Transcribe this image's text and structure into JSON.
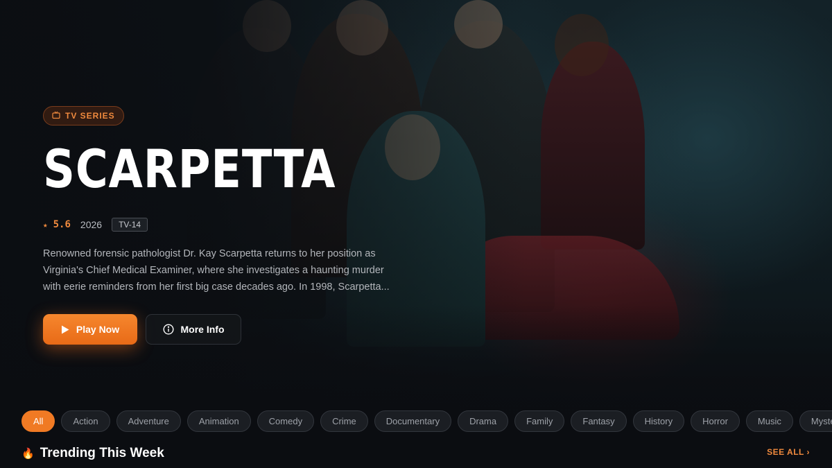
{
  "hero": {
    "type_badge": "TV SERIES",
    "title": "SCARPETTA",
    "rating": "5.6",
    "year": "2026",
    "age_rating": "TV-14",
    "description": "Renowned forensic pathologist Dr. Kay Scarpetta returns to her position as Virginia's Chief Medical Examiner, where she investigates a haunting murder with eerie reminders from her first big case decades ago. In 1998, Scarpetta...",
    "play_label": "Play Now",
    "info_label": "More Info"
  },
  "genres": [
    "All",
    "Action",
    "Adventure",
    "Animation",
    "Comedy",
    "Crime",
    "Documentary",
    "Drama",
    "Family",
    "Fantasy",
    "History",
    "Horror",
    "Music",
    "Mystery"
  ],
  "active_genre": "All",
  "section": {
    "title": "Trending This Week",
    "see_all": "SEE ALL ›"
  },
  "colors": {
    "accent": "#f07a24",
    "background": "#0b0d11"
  },
  "icons": {
    "badge": "tv-icon",
    "play": "play-icon",
    "info": "info-icon",
    "section": "fire-icon",
    "rating": "star-icon"
  }
}
